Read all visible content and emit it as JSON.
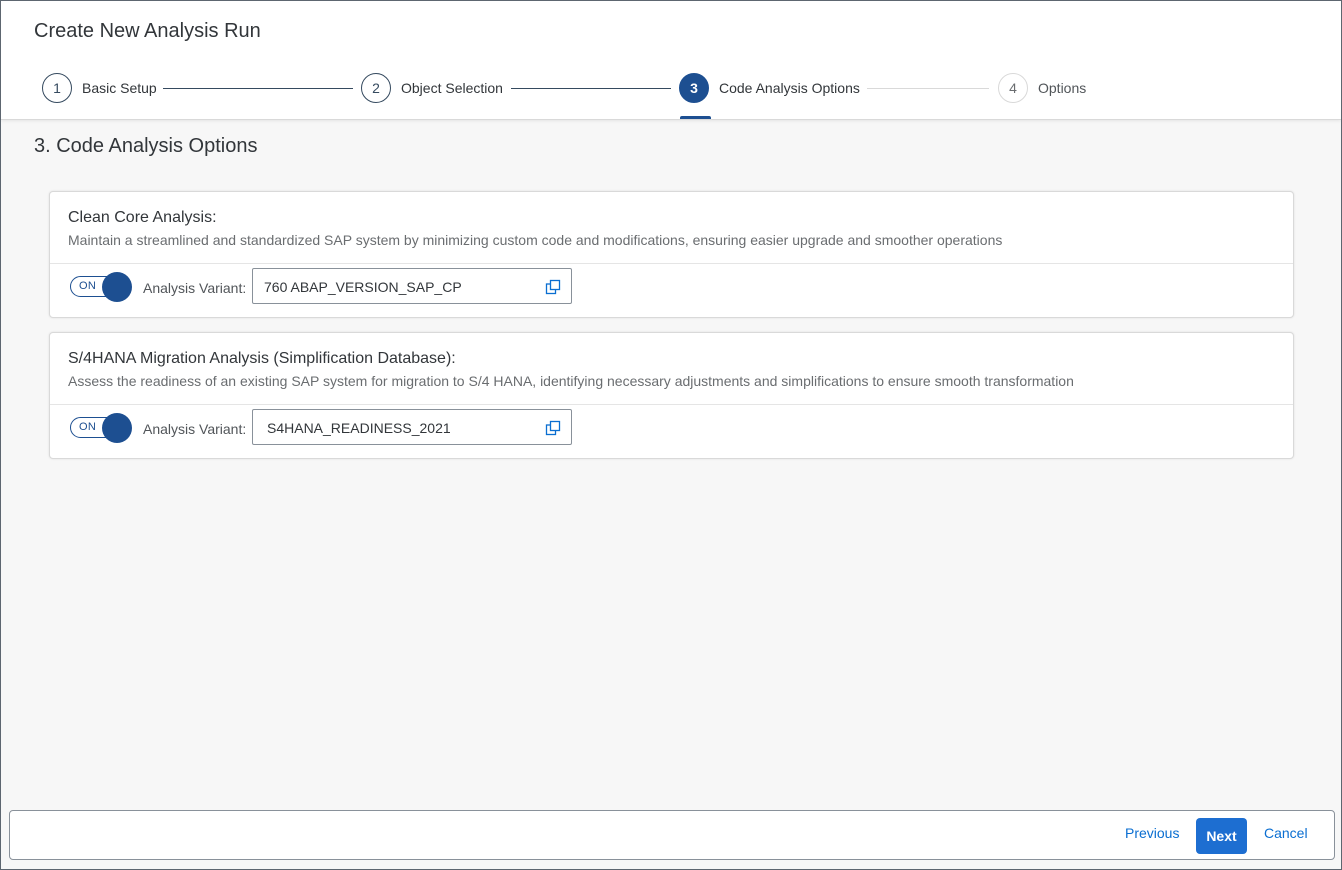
{
  "dialog": {
    "title": "Create New Analysis Run"
  },
  "wizard": {
    "steps": [
      {
        "number": "1",
        "label": "Basic Setup",
        "state": "done"
      },
      {
        "number": "2",
        "label": "Object Selection",
        "state": "done"
      },
      {
        "number": "3",
        "label": "Code Analysis Options",
        "state": "active"
      },
      {
        "number": "4",
        "label": "Options",
        "state": "future"
      }
    ]
  },
  "section": {
    "title": "3. Code Analysis Options"
  },
  "panels": [
    {
      "title": "Clean Core Analysis:",
      "description": "Maintain a streamlined and standardized SAP system by minimizing custom code and modifications, ensuring easier upgrade and smoother operations",
      "switch_text": "ON",
      "switch_on": true,
      "variant_label": "Analysis Variant:",
      "variant_value": "760 ABAP_VERSION_SAP_CP",
      "value_help_icon": "value-help-icon"
    },
    {
      "title": "S/4HANA Migration Analysis (Simplification Database):",
      "description": "Assess the readiness of an existing SAP system for migration to S/4 HANA, identifying necessary adjustments and simplifications to ensure smooth transformation",
      "switch_text": "ON",
      "switch_on": true,
      "variant_label": "Analysis Variant:",
      "variant_value": "S4HANA_READINESS_2021",
      "value_help_icon": "value-help-icon"
    }
  ],
  "footer": {
    "previous_label": "Previous",
    "next_label": "Next",
    "cancel_label": "Cancel"
  },
  "colors": {
    "brand": "#1d4f91",
    "emphasized_button": "#1d6ed1",
    "link": "#0a6ed1"
  }
}
